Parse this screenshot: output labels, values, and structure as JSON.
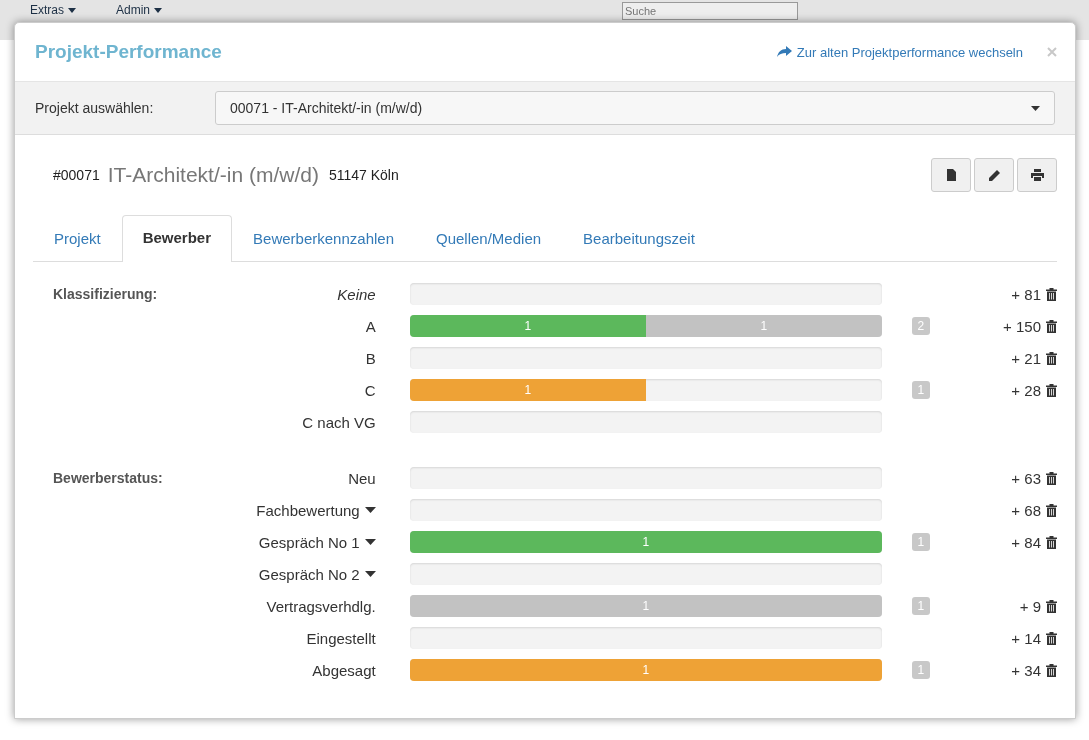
{
  "background_nav": [
    "Extras",
    "Admin"
  ],
  "background_search": {
    "placeholder": "Suche"
  },
  "modal": {
    "title": "Projekt-Performance",
    "switch_link": "Zur alten Projektperformance wechseln"
  },
  "project_select": {
    "label": "Projekt auswählen:",
    "value": "00071 - IT-Architekt/-in (m/w/d)"
  },
  "project": {
    "number": "#00071",
    "name": "IT-Architekt/-in (m/w/d)",
    "location": "51147 Köln"
  },
  "tabs": [
    {
      "label": "Projekt",
      "selected": false
    },
    {
      "label": "Bewerber",
      "selected": true
    },
    {
      "label": "Bewerberkennzahlen",
      "selected": false
    },
    {
      "label": "Quellen/Medien",
      "selected": false
    },
    {
      "label": "Bearbeitungszeit",
      "selected": false
    }
  ],
  "groups": [
    {
      "label": "Klassifizierung:",
      "rows": [
        {
          "label": "Keine",
          "italic": true,
          "has_menu": false,
          "segments": [],
          "total": "",
          "counter": "+ 81"
        },
        {
          "label": "A",
          "italic": false,
          "has_menu": false,
          "segments": [
            {
              "label": "1",
              "level": 0.5,
              "color": "#5cb85c"
            },
            {
              "label": "1",
              "level": 0.5,
              "color": "#c2c2c2"
            }
          ],
          "total": "2",
          "counter": "+ 150"
        },
        {
          "label": "B",
          "italic": false,
          "has_menu": false,
          "segments": [],
          "total": "",
          "counter": "+ 21"
        },
        {
          "label": "C",
          "italic": false,
          "has_menu": false,
          "segments": [
            {
              "label": "1",
              "level": 0.5,
              "color": "#eea236"
            }
          ],
          "total": "1",
          "counter": "+ 28"
        },
        {
          "label": "C nach VG",
          "italic": false,
          "has_menu": false,
          "segments": [],
          "total": "",
          "counter": ""
        }
      ]
    },
    {
      "label": "Bewerberstatus:",
      "rows": [
        {
          "label": "Neu",
          "italic": false,
          "has_menu": false,
          "segments": [],
          "total": "",
          "counter": "+ 63"
        },
        {
          "label": "Fachbewertung",
          "italic": false,
          "has_menu": true,
          "segments": [],
          "total": "",
          "counter": "+ 68"
        },
        {
          "label": "Gespräch No 1",
          "italic": false,
          "has_menu": true,
          "segments": [
            {
              "label": "1",
              "level": 1,
              "color": "#5cb85c"
            }
          ],
          "total": "1",
          "counter": "+ 84"
        },
        {
          "label": "Gespräch No 2",
          "italic": false,
          "has_menu": true,
          "segments": [],
          "total": "",
          "counter": ""
        },
        {
          "label": "Vertragsverhdlg.",
          "italic": false,
          "has_menu": false,
          "segments": [
            {
              "label": "1",
              "level": 1,
              "color": "#c2c2c2"
            }
          ],
          "total": "1",
          "counter": "+ 9"
        },
        {
          "label": "Eingestellt",
          "italic": false,
          "has_menu": false,
          "segments": [],
          "total": "",
          "counter": "+ 14"
        },
        {
          "label": "Abgesagt",
          "italic": false,
          "has_menu": false,
          "segments": [
            {
              "label": "1",
              "level": 1,
              "color": "#eea236"
            }
          ],
          "total": "1",
          "counter": "+ 34"
        }
      ]
    }
  ]
}
